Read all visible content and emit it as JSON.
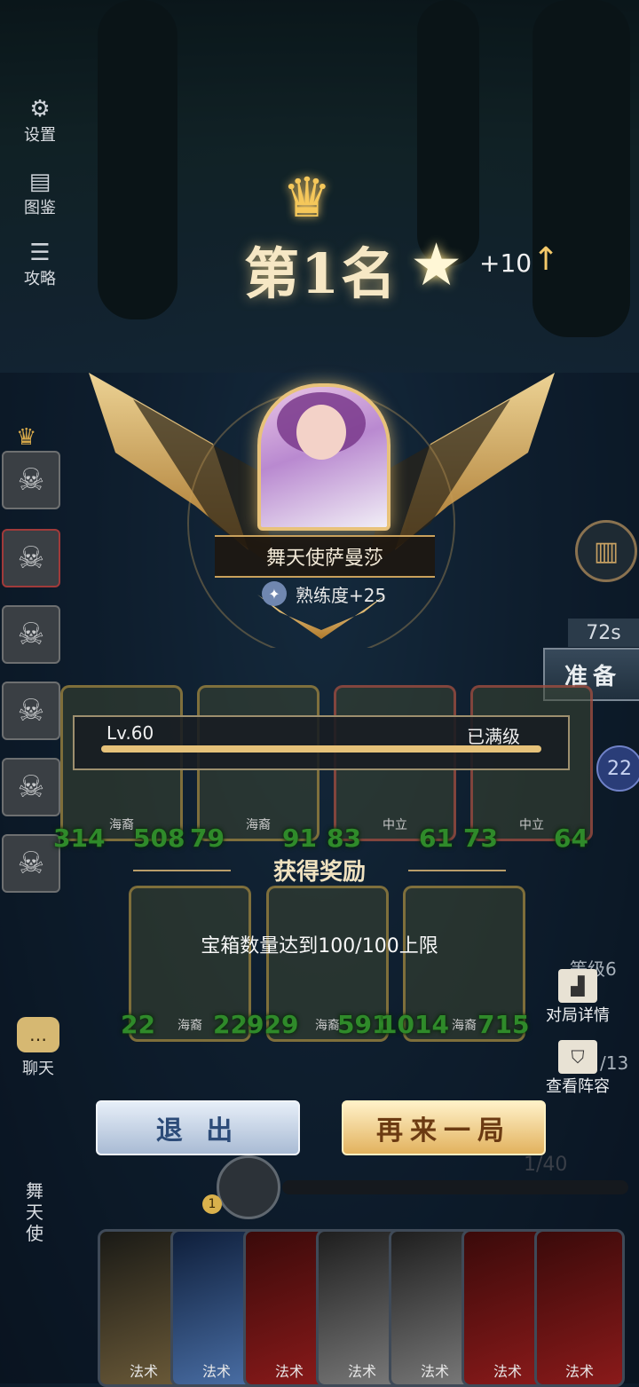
{
  "sidebar": {
    "settings_label": "设置",
    "codex_label": "图鉴",
    "guide_label": "攻略",
    "chat_label": "聊天"
  },
  "result": {
    "rank_text": "第1名",
    "star_change": "+10"
  },
  "hero": {
    "name": "舞天使萨曼莎",
    "mastery": "熟练度+25"
  },
  "right_panel": {
    "timer": "72s",
    "ready_label": "准备",
    "round_number": "22",
    "level_text": "等级6",
    "lineup_count": "/13",
    "match_details_label": "对局详情",
    "view_lineup_label": "查看阵容"
  },
  "level_bar": {
    "level": "Lv.60",
    "status": "已满级",
    "progress": 1.0
  },
  "board_top": [
    {
      "camp": "海裔",
      "attack": "314",
      "health": "508"
    },
    {
      "camp": "海裔",
      "attack": "79",
      "health": "91"
    },
    {
      "camp": "中立",
      "attack": "83",
      "health": "61"
    },
    {
      "camp": "中立",
      "attack": "73",
      "health": "64"
    }
  ],
  "board_bottom": [
    {
      "camp": "海裔",
      "attack": "22",
      "health": "22"
    },
    {
      "camp": "海裔",
      "attack": "929",
      "health": "591"
    },
    {
      "camp": "海裔",
      "attack": "1014",
      "health": "715"
    }
  ],
  "rewards": {
    "title": "获得奖励",
    "notice": "宝箱数量达到100/100上限"
  },
  "actions": {
    "exit_label": "退 出",
    "again_label": "再来一局"
  },
  "bottom": {
    "progress_text": "1/40",
    "coin": "1",
    "hero_vertical_name": "舞天使",
    "hand_cards": [
      {
        "label": "法术"
      },
      {
        "label": "法术"
      },
      {
        "label": "法术"
      },
      {
        "label": "法术"
      },
      {
        "label": "法术"
      },
      {
        "label": "法术"
      },
      {
        "label": "法术"
      }
    ]
  },
  "colors": {
    "gold": "#e8c27a",
    "stat_green": "#2f8a2a",
    "exit_blue": "#2c4b78",
    "again_brown": "#6b3a12"
  }
}
